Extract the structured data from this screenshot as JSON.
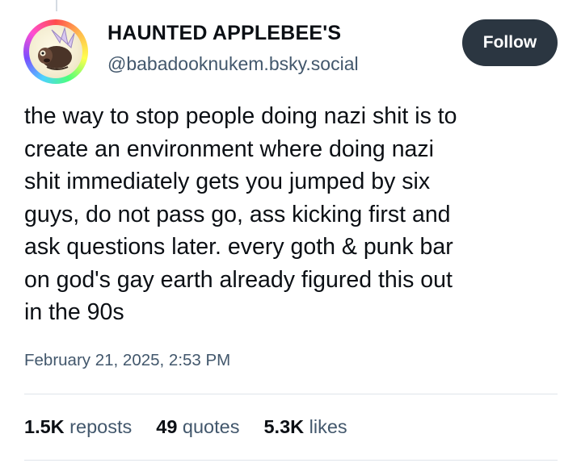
{
  "author": {
    "display_name": "HAUNTED APPLEBEE'S",
    "handle": "@babadooknukem.bsky.social",
    "avatar_icon": "rainbow-ring-creature-avatar"
  },
  "follow_button": {
    "label": "Follow"
  },
  "post": {
    "text": "the way to stop people doing nazi shit is to\ncreate an environment where doing nazi\nshit immediately gets you jumped by six\nguys, do not pass go, ass kicking first and\nask questions later. every goth & punk bar\non god's gay earth already figured this out\nin the 90s",
    "timestamp": "February 21, 2025, 2:53 PM"
  },
  "stats": {
    "reposts": {
      "count": "1.5K",
      "label": "reposts"
    },
    "quotes": {
      "count": "49",
      "label": "quotes"
    },
    "likes": {
      "count": "5.3K",
      "label": "likes"
    }
  },
  "colors": {
    "text": "#0b0f14",
    "secondary_text": "#42576c",
    "button_bg": "#2b3641",
    "button_text": "#ffffff",
    "divider": "#dfe4ea"
  }
}
